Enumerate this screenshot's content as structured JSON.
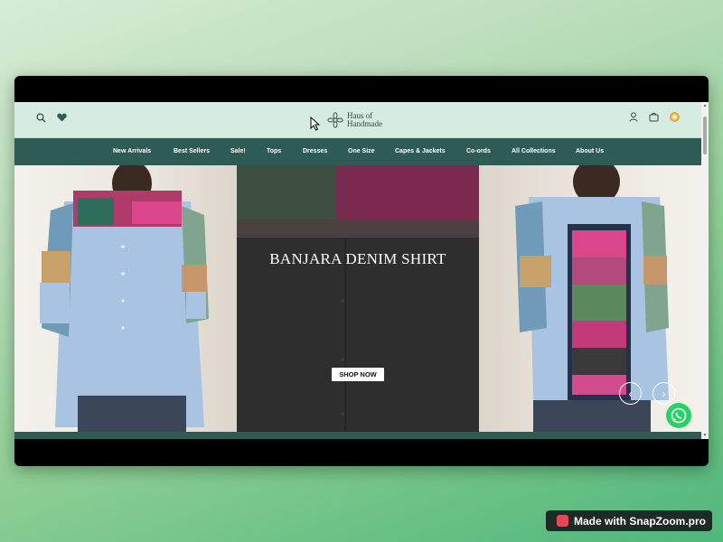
{
  "header": {
    "logo_line1": "Haus of",
    "logo_line2": "Handmade",
    "icons": [
      "search-icon",
      "heart-icon",
      "user-icon",
      "cart-icon",
      "currency-icon"
    ]
  },
  "nav": {
    "items": [
      {
        "label": "New Arrivals"
      },
      {
        "label": "Best Sellers"
      },
      {
        "label": "Sale!"
      },
      {
        "label": "Tops"
      },
      {
        "label": "Dresses"
      },
      {
        "label": "One Size"
      },
      {
        "label": "Capes & Jackets"
      },
      {
        "label": "Co-ords"
      },
      {
        "label": "All Collections"
      },
      {
        "label": "About Us"
      }
    ]
  },
  "hero": {
    "title": "BANJARA DENIM SHIRT",
    "cta": "SHOP NOW",
    "prev_icon": "chevron-left-icon",
    "next_icon": "chevron-right-icon"
  },
  "watermark": {
    "text": "Made with SnapZoom.pro"
  },
  "colors": {
    "header_bg": "#d6ece0",
    "nav_bg": "#2f5b55",
    "whatsapp": "#25d366",
    "brand_text": "#2f4a42"
  }
}
